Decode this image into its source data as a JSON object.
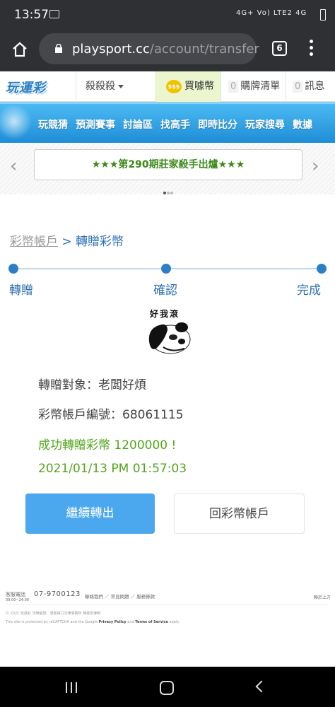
{
  "status_bar": {
    "time": "13:57",
    "signal_text": "4G+ Vo) LTE2 4G"
  },
  "browser": {
    "url_domain": "playsport.cc",
    "url_path": "/account/transfer",
    "tab_count": "6"
  },
  "site_header": {
    "logo": "玩運彩",
    "dropdown_label": "殺殺殺",
    "coin_icon": "$$$",
    "coin_label": "買噱幣",
    "cart_count": "0",
    "cart_label": "購牌清單",
    "msg_count": "0",
    "msg_label": "訊息"
  },
  "nav": {
    "items": [
      "玩競猜",
      "預測賽事",
      "討論區",
      "找高手",
      "即時比分",
      "玩家搜尋",
      "數據"
    ]
  },
  "promo": {
    "text": "★★★第290期莊家殺手出爐★★★",
    "left_arrow": "‹",
    "right_arrow": "›"
  },
  "breadcrumb": {
    "parent": "彩幣帳戶",
    "separator": " > ",
    "current": "轉贈彩幣"
  },
  "steps": [
    {
      "label": "轉贈"
    },
    {
      "label": "確認"
    },
    {
      "label": "完成"
    }
  ],
  "avatar": {
    "caption": "好我滾"
  },
  "result": {
    "recipient": "轉贈對象：老闆好煩",
    "account_no": "彩幣帳戶編號：68061115",
    "success": "成功轉贈彩幣 1200000 !",
    "datetime": "2021/01/13 PM 01:57:03"
  },
  "buttons": {
    "continue": "繼續轉出",
    "back": "回彩幣帳戶"
  },
  "footer": {
    "service_label": "客服電話",
    "service_hours": "09:00~24:00",
    "phone": "07-9700123",
    "links": "聯絡我們 ／ 常見問題 ／ 服務條款",
    "top_link": "聯於上方",
    "copyright": "© 2021 玩運彩 法律顧問：漢新得力法律事務所 陳振吉律師",
    "recaptcha_pre": "This site is protected by reCAPTCHA and the Google ",
    "privacy": "Privacy Policy",
    "and": " and ",
    "terms": "Terms of Service",
    "apply": " apply."
  },
  "colors": {
    "accent_blue": "#4ca8ee",
    "success_green": "#52a51d",
    "step_blue": "#2d7ec9"
  }
}
